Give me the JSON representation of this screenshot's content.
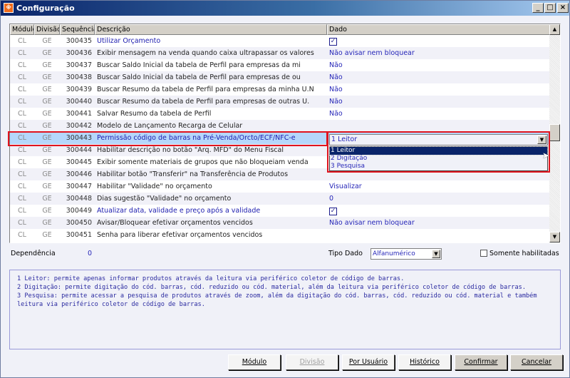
{
  "window": {
    "title": "Configuração",
    "min": "_",
    "max": "□",
    "close": "×"
  },
  "grid": {
    "headers": [
      "Módulo",
      "Divisão",
      "Sequência",
      "Descrição",
      "Dado"
    ],
    "rows": [
      {
        "modulo": "CL",
        "divisao": "GE",
        "seq": "300435",
        "desc": "Utilizar Orçamento",
        "dado": "",
        "check": true,
        "blue": true
      },
      {
        "modulo": "CL",
        "divisao": "GE",
        "seq": "300436",
        "desc": "Exibir mensagem na venda quando caixa ultrapassar os valores",
        "dado": "Não avisar nem bloquear"
      },
      {
        "modulo": "CL",
        "divisao": "GE",
        "seq": "300437",
        "desc": "Buscar Saldo Inicial da tabela de Perfil para empresas da mi",
        "dado": "Não"
      },
      {
        "modulo": "CL",
        "divisao": "GE",
        "seq": "300438",
        "desc": "Buscar Saldo Inicial da tabela de Perfil para empresas de ou",
        "dado": "Não"
      },
      {
        "modulo": "CL",
        "divisao": "GE",
        "seq": "300439",
        "desc": "Buscar Resumo da tabela de Perfil para empresas da minha U.N",
        "dado": "Não"
      },
      {
        "modulo": "CL",
        "divisao": "GE",
        "seq": "300440",
        "desc": "Buscar Resumo da tabela de Perfil para empresas de outras U.",
        "dado": "Não"
      },
      {
        "modulo": "CL",
        "divisao": "GE",
        "seq": "300441",
        "desc": "Salvar Resumo da tabela de Perfil",
        "dado": "Não"
      },
      {
        "modulo": "CL",
        "divisao": "GE",
        "seq": "300442",
        "desc": "Modelo de Lançamento Recarga de Celular",
        "dado": ""
      },
      {
        "modulo": "CL",
        "divisao": "GE",
        "seq": "300443",
        "desc": "Permissão código de barras na Pré-Venda/Orcto/ECF/NFC-e",
        "dado": "",
        "selected": true,
        "blue": true
      },
      {
        "modulo": "CL",
        "divisao": "GE",
        "seq": "300444",
        "desc": "Habilitar descrição no botão \"Arq. MFD\" do Menu Fiscal",
        "dado": ""
      },
      {
        "modulo": "CL",
        "divisao": "GE",
        "seq": "300445",
        "desc": "Exibir somente materiais de grupos que não bloqueiam venda",
        "dado": ""
      },
      {
        "modulo": "CL",
        "divisao": "GE",
        "seq": "300446",
        "desc": "Habilitar botão \"Transferir\" na Transferência de Produtos",
        "dado": ""
      },
      {
        "modulo": "CL",
        "divisao": "GE",
        "seq": "300447",
        "desc": "Habilitar \"Validade\" no orçamento",
        "dado": "Visualizar"
      },
      {
        "modulo": "CL",
        "divisao": "GE",
        "seq": "300448",
        "desc": "Dias sugestão \"Validade\" no orçamento",
        "dado": "0"
      },
      {
        "modulo": "CL",
        "divisao": "GE",
        "seq": "300449",
        "desc": "Atualizar data, validade e preço após a validade",
        "dado": "",
        "check": true,
        "blue": true
      },
      {
        "modulo": "CL",
        "divisao": "GE",
        "seq": "300450",
        "desc": "Avisar/Bloquear efetivar orçamentos vencidos",
        "dado": "Não avisar nem bloquear"
      },
      {
        "modulo": "CL",
        "divisao": "GE",
        "seq": "300451",
        "desc": "Senha para liberar efetivar orçamentos vencidos",
        "dado": ""
      }
    ],
    "combo": {
      "value": "1 Leitor",
      "options": [
        "1 Leitor",
        "2 Digitação",
        "3 Pesquisa"
      ]
    }
  },
  "footer": {
    "dependencia_label": "Dependência",
    "dependencia_value": "0",
    "tipo_dado_label": "Tipo Dado",
    "tipo_dado_value": "Alfanumérico",
    "somente_label": "Somente habilitadas"
  },
  "memo": [
    "1 Leitor: permite apenas informar produtos através da leitura via periférico coletor de código de barras.",
    "2 Digitação: permite digitação do cód. barras, cód. reduzido ou cód. material, além da leitura via periférico coletor de código de barras.",
    "3 Pesquisa: permite acessar a pesquisa de produtos através de zoom, além da digitação do cód. barras, cód. reduzido ou cód. material e também leitura via periférico coletor de código de barras."
  ],
  "buttons": {
    "modulo": "Módulo",
    "divisao": "Divisão",
    "por_usuario": "Por Usuário",
    "historico": "Histórico",
    "confirmar": "Confirmar",
    "cancelar": "Cancelar"
  }
}
